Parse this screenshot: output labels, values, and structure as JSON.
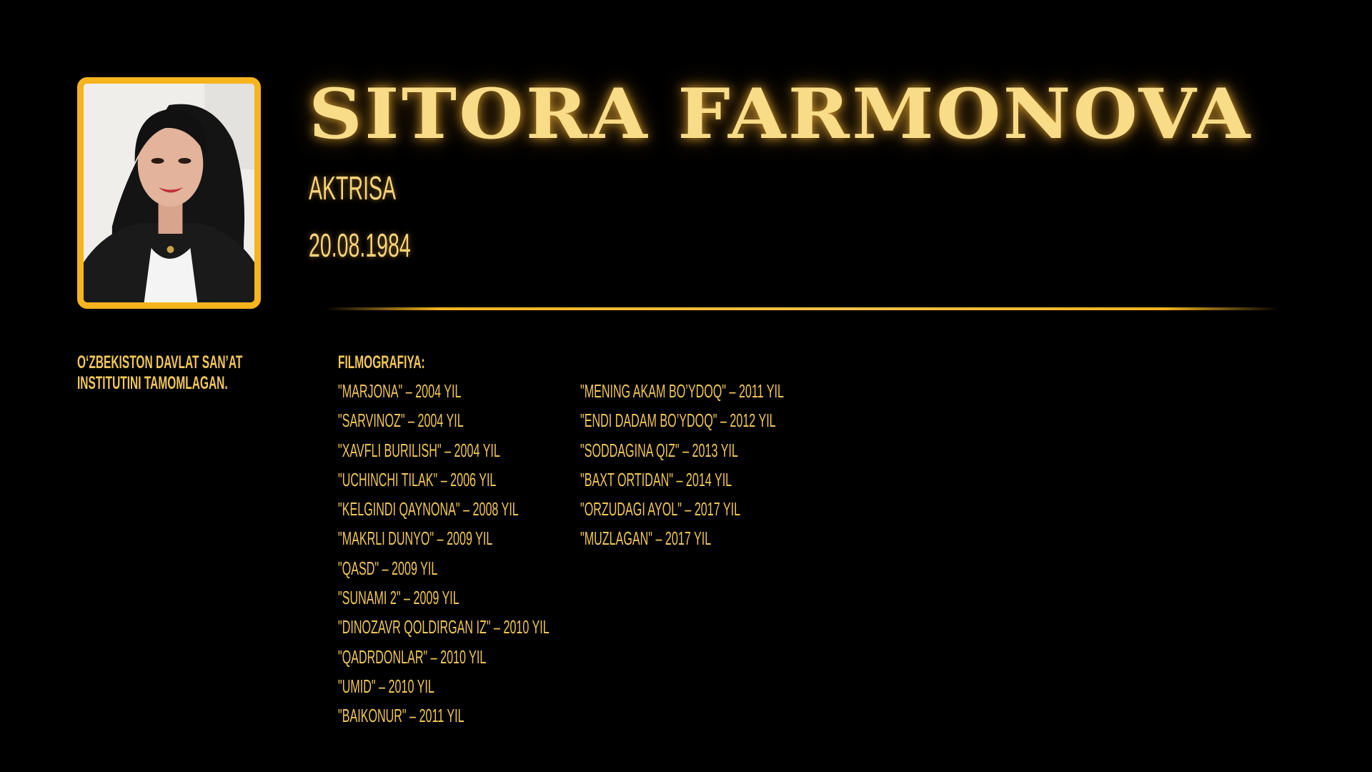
{
  "profile": {
    "name": "SITORA FARMONOVA",
    "role": "AKTRISA",
    "birth_date": "20.08.1984",
    "education": [
      "O‘ZBEKISTON DAVLAT SAN’AT",
      "INSTITUTINI TAMOMLAGAN."
    ]
  },
  "filmography": {
    "title": "FILMOGRAFIYA:",
    "column_1": [
      "\"MARJONA\" – 2004 YIL",
      "\"SARVINOZ\" – 2004 YIL",
      "\"XAVFLI BURILISH\" – 2004 YIL",
      "\"UCHINCHI TILAK\" – 2006 YIL",
      "\"KELGINDI QAYNONA\" – 2008 YIL",
      "\"MAKRLI DUNYO\" – 2009 YIL",
      "\"QASD\" – 2009 YIL",
      "\"SUNAMI 2\" – 2009 YIL",
      "\"DINOZAVR QOLDIRGAN IZ\" – 2010 YIL",
      "\"QADRDONLAR\" – 2010 YIL",
      "\"UMID\" – 2010 YIL",
      "\"BAIKONUR\" – 2011 YIL"
    ],
    "column_2": [
      "\"MENING AKAM BO’YDOQ\" – 2011 YIL",
      "\"ENDI DADAM BO’YDOQ\" – 2012 YIL",
      "\"SODDAGINA QIZ\" – 2013 YIL",
      "\"BAXT ORTIDAN\" – 2014 YIL",
      "\"ORZUDAGI AYOL\" – 2017 YIL",
      "\"MUZLAGAN\" – 2017 YIL"
    ]
  },
  "colors": {
    "background": "#000000",
    "gold_accent": "#f6b41f",
    "text_gold": "#f2c757",
    "title_gold": "#f8dc88"
  }
}
